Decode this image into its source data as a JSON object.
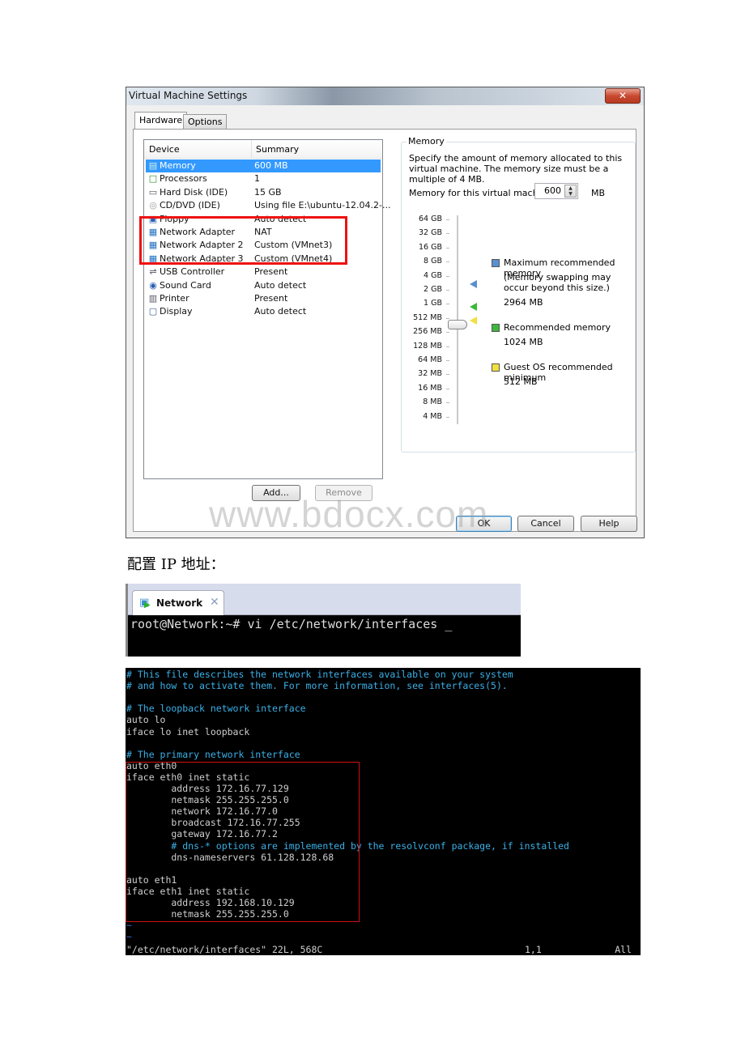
{
  "dialog": {
    "title": "Virtual Machine Settings",
    "close_icon": "close-icon",
    "tabs": [
      {
        "label": "Hardware",
        "active": true
      },
      {
        "label": "Options",
        "active": false
      }
    ],
    "device_list": {
      "columns": [
        "Device",
        "Summary"
      ],
      "rows": [
        {
          "icon": "memory-icon",
          "device": "Memory",
          "summary": "600 MB",
          "selected": true
        },
        {
          "icon": "processor-icon",
          "device": "Processors",
          "summary": "1"
        },
        {
          "icon": "hard-disk-icon",
          "device": "Hard Disk (IDE)",
          "summary": "15 GB"
        },
        {
          "icon": "cd-dvd-icon",
          "device": "CD/DVD (IDE)",
          "summary": "Using file E:\\ubuntu-12.04.2-..."
        },
        {
          "icon": "floppy-icon",
          "device": "Floppy",
          "summary": "Auto detect"
        },
        {
          "icon": "network-adapter-icon",
          "device": "Network Adapter",
          "summary": "NAT"
        },
        {
          "icon": "network-adapter-icon",
          "device": "Network Adapter 2",
          "summary": "Custom (VMnet3)"
        },
        {
          "icon": "network-adapter-icon",
          "device": "Network Adapter 3",
          "summary": "Custom (VMnet4)"
        },
        {
          "icon": "usb-controller-icon",
          "device": "USB Controller",
          "summary": "Present"
        },
        {
          "icon": "sound-card-icon",
          "device": "Sound Card",
          "summary": "Auto detect"
        },
        {
          "icon": "printer-icon",
          "device": "Printer",
          "summary": "Present"
        },
        {
          "icon": "display-icon",
          "device": "Display",
          "summary": "Auto detect"
        }
      ]
    },
    "add_label": "Add...",
    "remove_label": "Remove",
    "memory": {
      "group_label": "Memory",
      "description": "Specify the amount of memory allocated to this virtual machine. The memory size must be a multiple of 4 MB.",
      "field_label": "Memory for this virtual machine:",
      "value": "600",
      "unit": "MB",
      "scale": [
        "64 GB",
        "32 GB",
        "16 GB",
        "8 GB",
        "4 GB",
        "2 GB",
        "1 GB",
        "512 MB",
        "256 MB",
        "128 MB",
        "64 MB",
        "32 MB",
        "16 MB",
        "8 MB",
        "4 MB"
      ],
      "legend": {
        "max_label": "Maximum recommended memory",
        "max_note": "(Memory swapping may occur beyond this size.)",
        "max_value": "2964 MB",
        "rec_label": "Recommended memory",
        "rec_value": "1024 MB",
        "min_label": "Guest OS recommended minimum",
        "min_value": "512 MB"
      },
      "colors": {
        "max": "#5b8fd0",
        "rec": "#3cb83c",
        "min": "#f0e040"
      }
    },
    "ok_label": "OK",
    "cancel_label": "Cancel",
    "help_label": "Help"
  },
  "watermark": "www.bdocx.com",
  "caption": "配置 IP 地址：",
  "console": {
    "tab_label": "Network",
    "command_line": "root@Network:~# vi /etc/network/interfaces _"
  },
  "vi": {
    "lines": [
      {
        "text": "# This file describes the network interfaces available on your system",
        "type": "comment"
      },
      {
        "text": "# and how to activate them. For more information, see interfaces(5).",
        "type": "comment"
      },
      {
        "text": "",
        "type": "text"
      },
      {
        "text": "# The loopback network interface",
        "type": "comment"
      },
      {
        "text": "auto lo",
        "type": "text"
      },
      {
        "text": "iface lo inet loopback",
        "type": "text"
      },
      {
        "text": "",
        "type": "text"
      },
      {
        "text": "# The primary network interface",
        "type": "comment"
      },
      {
        "text": "auto eth0",
        "type": "text"
      },
      {
        "text": "iface eth0 inet static",
        "type": "text"
      },
      {
        "text": "        address 172.16.77.129",
        "type": "text"
      },
      {
        "text": "        netmask 255.255.255.0",
        "type": "text"
      },
      {
        "text": "        network 172.16.77.0",
        "type": "text"
      },
      {
        "text": "        broadcast 172.16.77.255",
        "type": "text"
      },
      {
        "text": "        gateway 172.16.77.2",
        "type": "text"
      },
      {
        "text": "        # dns-* options are implemented by the resolvconf package, if installed",
        "type": "comment"
      },
      {
        "text": "        dns-nameservers 61.128.128.68",
        "type": "text"
      },
      {
        "text": "",
        "type": "text"
      },
      {
        "text": "auto eth1",
        "type": "text"
      },
      {
        "text": "iface eth1 inet static",
        "type": "text"
      },
      {
        "text": "        address 192.168.10.129",
        "type": "text"
      },
      {
        "text": "        netmask 255.255.255.0",
        "type": "text"
      },
      {
        "text": "~",
        "type": "tilde"
      },
      {
        "text": "~",
        "type": "tilde"
      }
    ],
    "status_file": "\"/etc/network/interfaces\" 22L, 568C",
    "status_pos": "1,1",
    "status_scroll": "All"
  }
}
